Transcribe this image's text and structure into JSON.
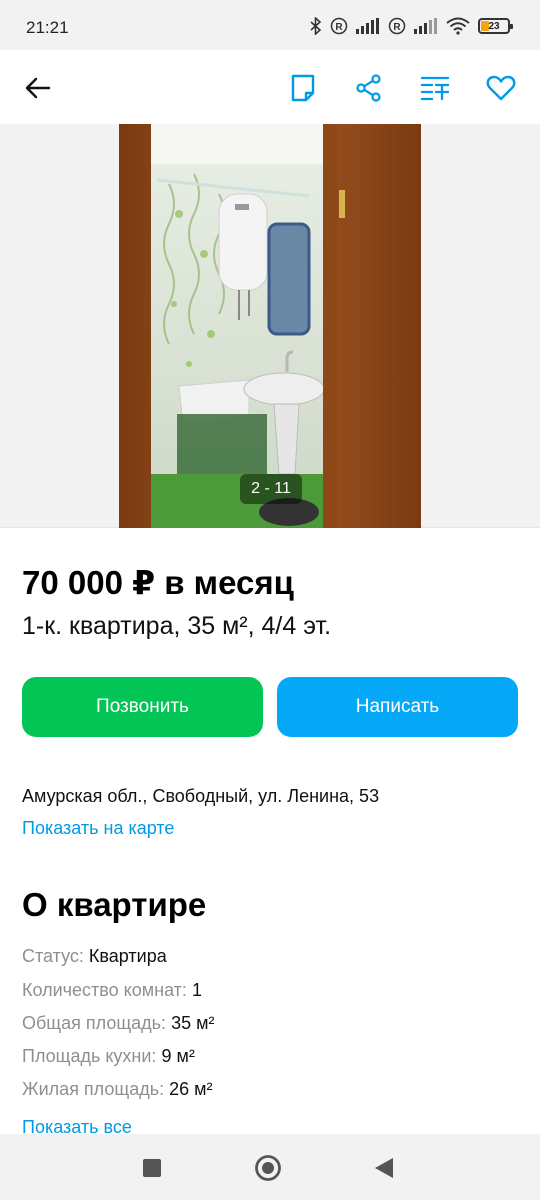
{
  "status_bar": {
    "time": "21:21",
    "battery_level": "23",
    "icons": [
      "bluetooth-icon",
      "roaming-icon",
      "signal-icon",
      "roaming-icon",
      "signal-icon",
      "wifi-icon",
      "battery-icon"
    ]
  },
  "app_bar": {
    "icons": [
      "back-arrow-icon",
      "note-icon",
      "share-icon",
      "compare-icon",
      "heart-icon"
    ],
    "accent": "#0099e5"
  },
  "gallery": {
    "counter": "2 - 11"
  },
  "listing": {
    "price": "70 000 ₽ в месяц",
    "subtitle": "1-к. квартира, 35 м², 4/4 эт."
  },
  "actions": {
    "call_label": "Позвонить",
    "call_color": "#03c556",
    "write_label": "Написать",
    "write_color": "#05a8f7"
  },
  "location": {
    "address": "Амурская обл., Свободный, ул. Ленина, 53",
    "map_link": "Показать на карте"
  },
  "about": {
    "title": "О квартире",
    "params": [
      {
        "key": "Статус:",
        "value": "Квартира"
      },
      {
        "key": "Количество комнат:",
        "value": "1"
      },
      {
        "key": "Общая площадь:",
        "value": "35 м²"
      },
      {
        "key": "Площадь кухни:",
        "value": "9 м²"
      },
      {
        "key": "Жилая площадь:",
        "value": "26 м²"
      }
    ],
    "show_all": "Показать все"
  },
  "nav_bar": {
    "icons": [
      "recents-square-icon",
      "home-circle-icon",
      "back-triangle-icon"
    ]
  }
}
